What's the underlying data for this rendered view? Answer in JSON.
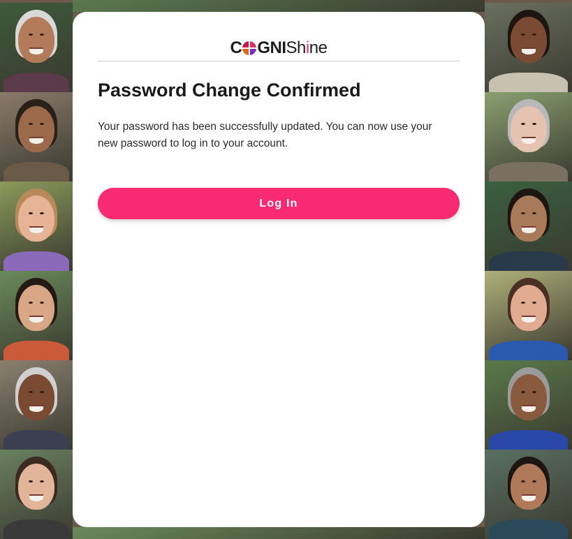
{
  "logo": {
    "part1": "C",
    "part2": "GNI",
    "part3": "Sh",
    "part4": "i",
    "part5": "ne"
  },
  "heading": "Password Change Confirmed",
  "message": "Your password has been successfully updated. You can now use your new password to log in to your account.",
  "login_button": "Log In",
  "colors": {
    "accent": "#f72a72",
    "card_background": "#ffffff",
    "text": "#1a1a1a"
  },
  "background": {
    "description_icon": "portrait-photo-collage",
    "portraits": [
      {
        "skin": "#b37b5a",
        "hair": "#d8d8d8",
        "shirt": "#5b3b4a",
        "bg": "#3d5a3a"
      },
      {
        "skin": "#9a6a4a",
        "hair": "#2a201a",
        "shirt": "#6a5a48",
        "bg": "#8a7a6a"
      },
      {
        "skin": "#e6b396",
        "hair": "#b88a5a",
        "shirt": "#8a6ab8",
        "bg": "#8a9a5a"
      },
      {
        "skin": "#d9a785",
        "hair": "#241a15",
        "shirt": "#cb5a3a",
        "bg": "#6a8a5a"
      },
      {
        "skin": "#7a4a32",
        "hair": "#cfcfcf",
        "shirt": "#3a4050",
        "bg": "#8a8070"
      },
      {
        "skin": "#e2b49a",
        "hair": "#3a2a20",
        "shirt": "#3a3a3a",
        "bg": "#6a8060"
      },
      {
        "skin": "#7a4a34",
        "hair": "#1d1510",
        "shirt": "#c8c0b0",
        "bg": "#6a7060"
      },
      {
        "skin": "#e4c3b0",
        "hair": "#b8b8b8",
        "shirt": "#7a7062",
        "bg": "#8aa070"
      },
      {
        "skin": "#a87a5a",
        "hair": "#1d1510",
        "shirt": "#2a3a4a",
        "bg": "#3a6040"
      },
      {
        "skin": "#e0ab90",
        "hair": "#4a3022",
        "shirt": "#2a5ab0",
        "bg": "#b0b07a"
      },
      {
        "skin": "#8a5a3e",
        "hair": "#9a9a9a",
        "shirt": "#2a48a8",
        "bg": "#5a7a4a"
      },
      {
        "skin": "#b07a5a",
        "hair": "#1d1510",
        "shirt": "#2a4a5a",
        "bg": "#5a7060"
      },
      {
        "skin": "#a87050",
        "hair": "#1d1510",
        "shirt": "#d07a7a",
        "bg": "#5a7a50"
      },
      {
        "skin": "#dcae94",
        "hair": "#f2f2f2",
        "shirt": "#d0603a",
        "bg": "#6a8a5a"
      }
    ]
  }
}
